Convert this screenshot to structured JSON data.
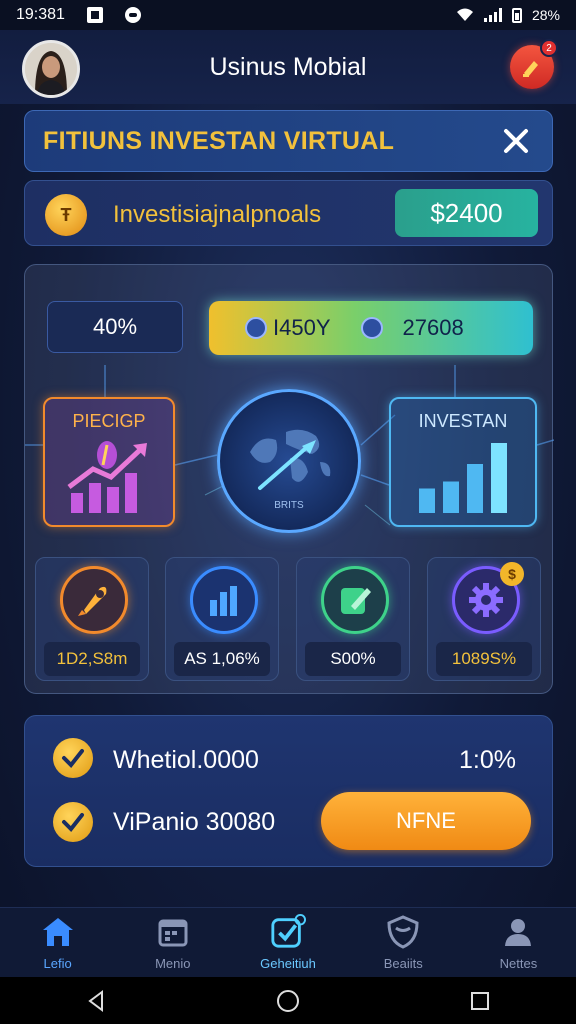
{
  "status_bar": {
    "time": "19:381",
    "battery": "28%"
  },
  "header": {
    "title": "Usinus Mobial",
    "notification_count": "2"
  },
  "banner": {
    "title": "FITIUNS INVESTAN VIRTUAL"
  },
  "info": {
    "label": "Investisiajnalpnoals",
    "balance": "$2400"
  },
  "dashboard": {
    "percent": "40%",
    "stat_one": "I450Y",
    "stat_two": "27608",
    "profit_card_label": "PIECIGP",
    "invest_card_label": "INVESTAN",
    "globe_label": "BRITS",
    "chart_bars": [
      0.35,
      0.45,
      0.7,
      1.0
    ],
    "tiles": [
      {
        "icon": "rocket-icon",
        "value": "1D2,S8m"
      },
      {
        "icon": "bar-chart-icon",
        "value": "AS 1,06%"
      },
      {
        "icon": "edit-icon",
        "value": "S00%"
      },
      {
        "icon": "gear-icon",
        "value": "1089S%"
      }
    ]
  },
  "summary": {
    "row1_label": "Whetiol.0000",
    "row1_percent": "1:0%",
    "row2_label": "ViPanio 30080",
    "action_button": "NFNE"
  },
  "nav": {
    "items": [
      {
        "label": "Lefio",
        "icon": "home-icon"
      },
      {
        "label": "Menio",
        "icon": "calendar-icon"
      },
      {
        "label": "Geheitiuh",
        "icon": "check-badge-icon"
      },
      {
        "label": "Beaiits",
        "icon": "shield-icon"
      },
      {
        "label": "Nettes",
        "icon": "profile-icon"
      }
    ]
  },
  "colors": {
    "accent_gold": "#f2c13c",
    "accent_teal": "#27b3a0",
    "accent_orange": "#f08a14",
    "background": "#101a38"
  }
}
